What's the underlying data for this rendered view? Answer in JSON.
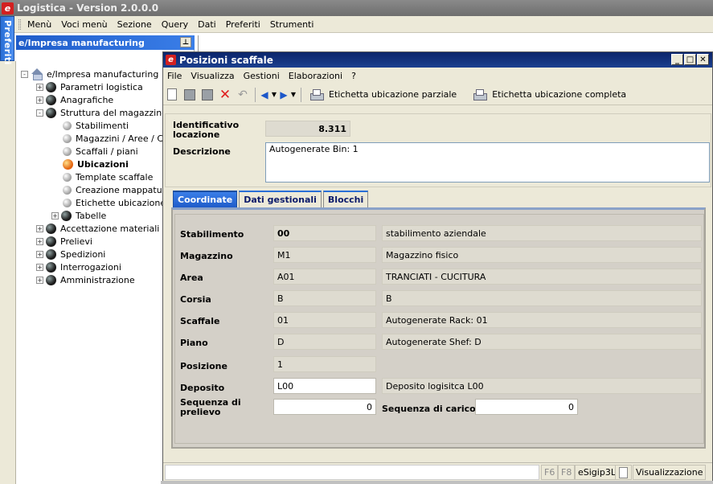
{
  "app": {
    "title": "Logistica - Version 2.0.0.0",
    "logo": "e",
    "menu": [
      "Menù",
      "Voci menù",
      "Sezione",
      "Query",
      "Dati",
      "Preferiti",
      "Strumenti"
    ]
  },
  "preferiti_tab": "Preferiti",
  "tree": {
    "header": "e/Impresa manufacturing",
    "pin": "⊥",
    "root": "e/Impresa manufacturing",
    "items": [
      {
        "label": "Parametri logistica",
        "level": 1,
        "toggle": "+",
        "icon": "dark"
      },
      {
        "label": "Anagrafiche",
        "level": 1,
        "toggle": "+",
        "icon": "dark"
      },
      {
        "label": "Struttura del magazzino",
        "level": 1,
        "toggle": "-",
        "icon": "dark"
      },
      {
        "label": "Stabilimenti",
        "level": 2,
        "toggle": "",
        "icon": "grey"
      },
      {
        "label": "Magazzini / Aree / Co",
        "level": 2,
        "toggle": "",
        "icon": "grey"
      },
      {
        "label": "Scaffali / piani",
        "level": 2,
        "toggle": "",
        "icon": "grey"
      },
      {
        "label": "Ubicazioni",
        "level": 2,
        "toggle": "",
        "icon": "orange",
        "selected": true
      },
      {
        "label": "Template scaffale",
        "level": 2,
        "toggle": "",
        "icon": "grey"
      },
      {
        "label": "Creazione mappatura",
        "level": 2,
        "toggle": "",
        "icon": "grey"
      },
      {
        "label": "Etichette ubicazione",
        "level": 2,
        "toggle": "",
        "icon": "grey"
      },
      {
        "label": "Tabelle",
        "level": 2,
        "toggle": "+",
        "icon": "dark"
      },
      {
        "label": "Accettazione materiali",
        "level": 1,
        "toggle": "+",
        "icon": "dark"
      },
      {
        "label": "Prelievi",
        "level": 1,
        "toggle": "+",
        "icon": "dark"
      },
      {
        "label": "Spedizioni",
        "level": 1,
        "toggle": "+",
        "icon": "dark"
      },
      {
        "label": "Interrogazioni",
        "level": 1,
        "toggle": "+",
        "icon": "dark"
      },
      {
        "label": "Amministrazione",
        "level": 1,
        "toggle": "+",
        "icon": "dark"
      }
    ]
  },
  "dialog": {
    "title": "Posizioni scaffale",
    "menu": [
      "File",
      "Visualizza",
      "Gestioni",
      "Elaborazioni",
      "?"
    ],
    "toolbar": {
      "print_partial": "Etichetta ubicazione parziale",
      "print_full": "Etichetta ubicazione completa"
    },
    "header": {
      "id_label": "Identificativo locazione",
      "id_value": "8.311",
      "desc_label": "Descrizione",
      "desc_value": "Autogenerate Bin: 1"
    },
    "tabs": [
      "Coordinate",
      "Dati gestionali",
      "Blocchi"
    ],
    "active_tab": "Coordinate",
    "fields": {
      "stabilimento": {
        "label": "Stabilimento",
        "code": "00",
        "desc": "stabilimento aziendale"
      },
      "magazzino": {
        "label": "Magazzino",
        "code": "M1",
        "desc": "Magazzino fisico"
      },
      "area": {
        "label": "Area",
        "code": "A01",
        "desc": "TRANCIATI - CUCITURA"
      },
      "corsia": {
        "label": "Corsia",
        "code": "B",
        "desc": "B"
      },
      "scaffale": {
        "label": "Scaffale",
        "code": "01",
        "desc": "Autogenerate Rack: 01"
      },
      "piano": {
        "label": "Piano",
        "code": "D",
        "desc": "Autogenerate Shef: D"
      },
      "posizione": {
        "label": "Posizione",
        "code": "1"
      },
      "deposito": {
        "label": "Deposito",
        "code": "L00",
        "desc": "Deposito logisitca L00"
      },
      "seq_prelievo": {
        "label": "Sequenza di prelievo",
        "value": "0"
      },
      "seq_carico": {
        "label": "Sequenza di carico",
        "value": "0"
      }
    },
    "status": {
      "f6": "F6",
      "f8": "F8",
      "user": "eSigip3L",
      "mode": "Visualizzazione"
    }
  }
}
